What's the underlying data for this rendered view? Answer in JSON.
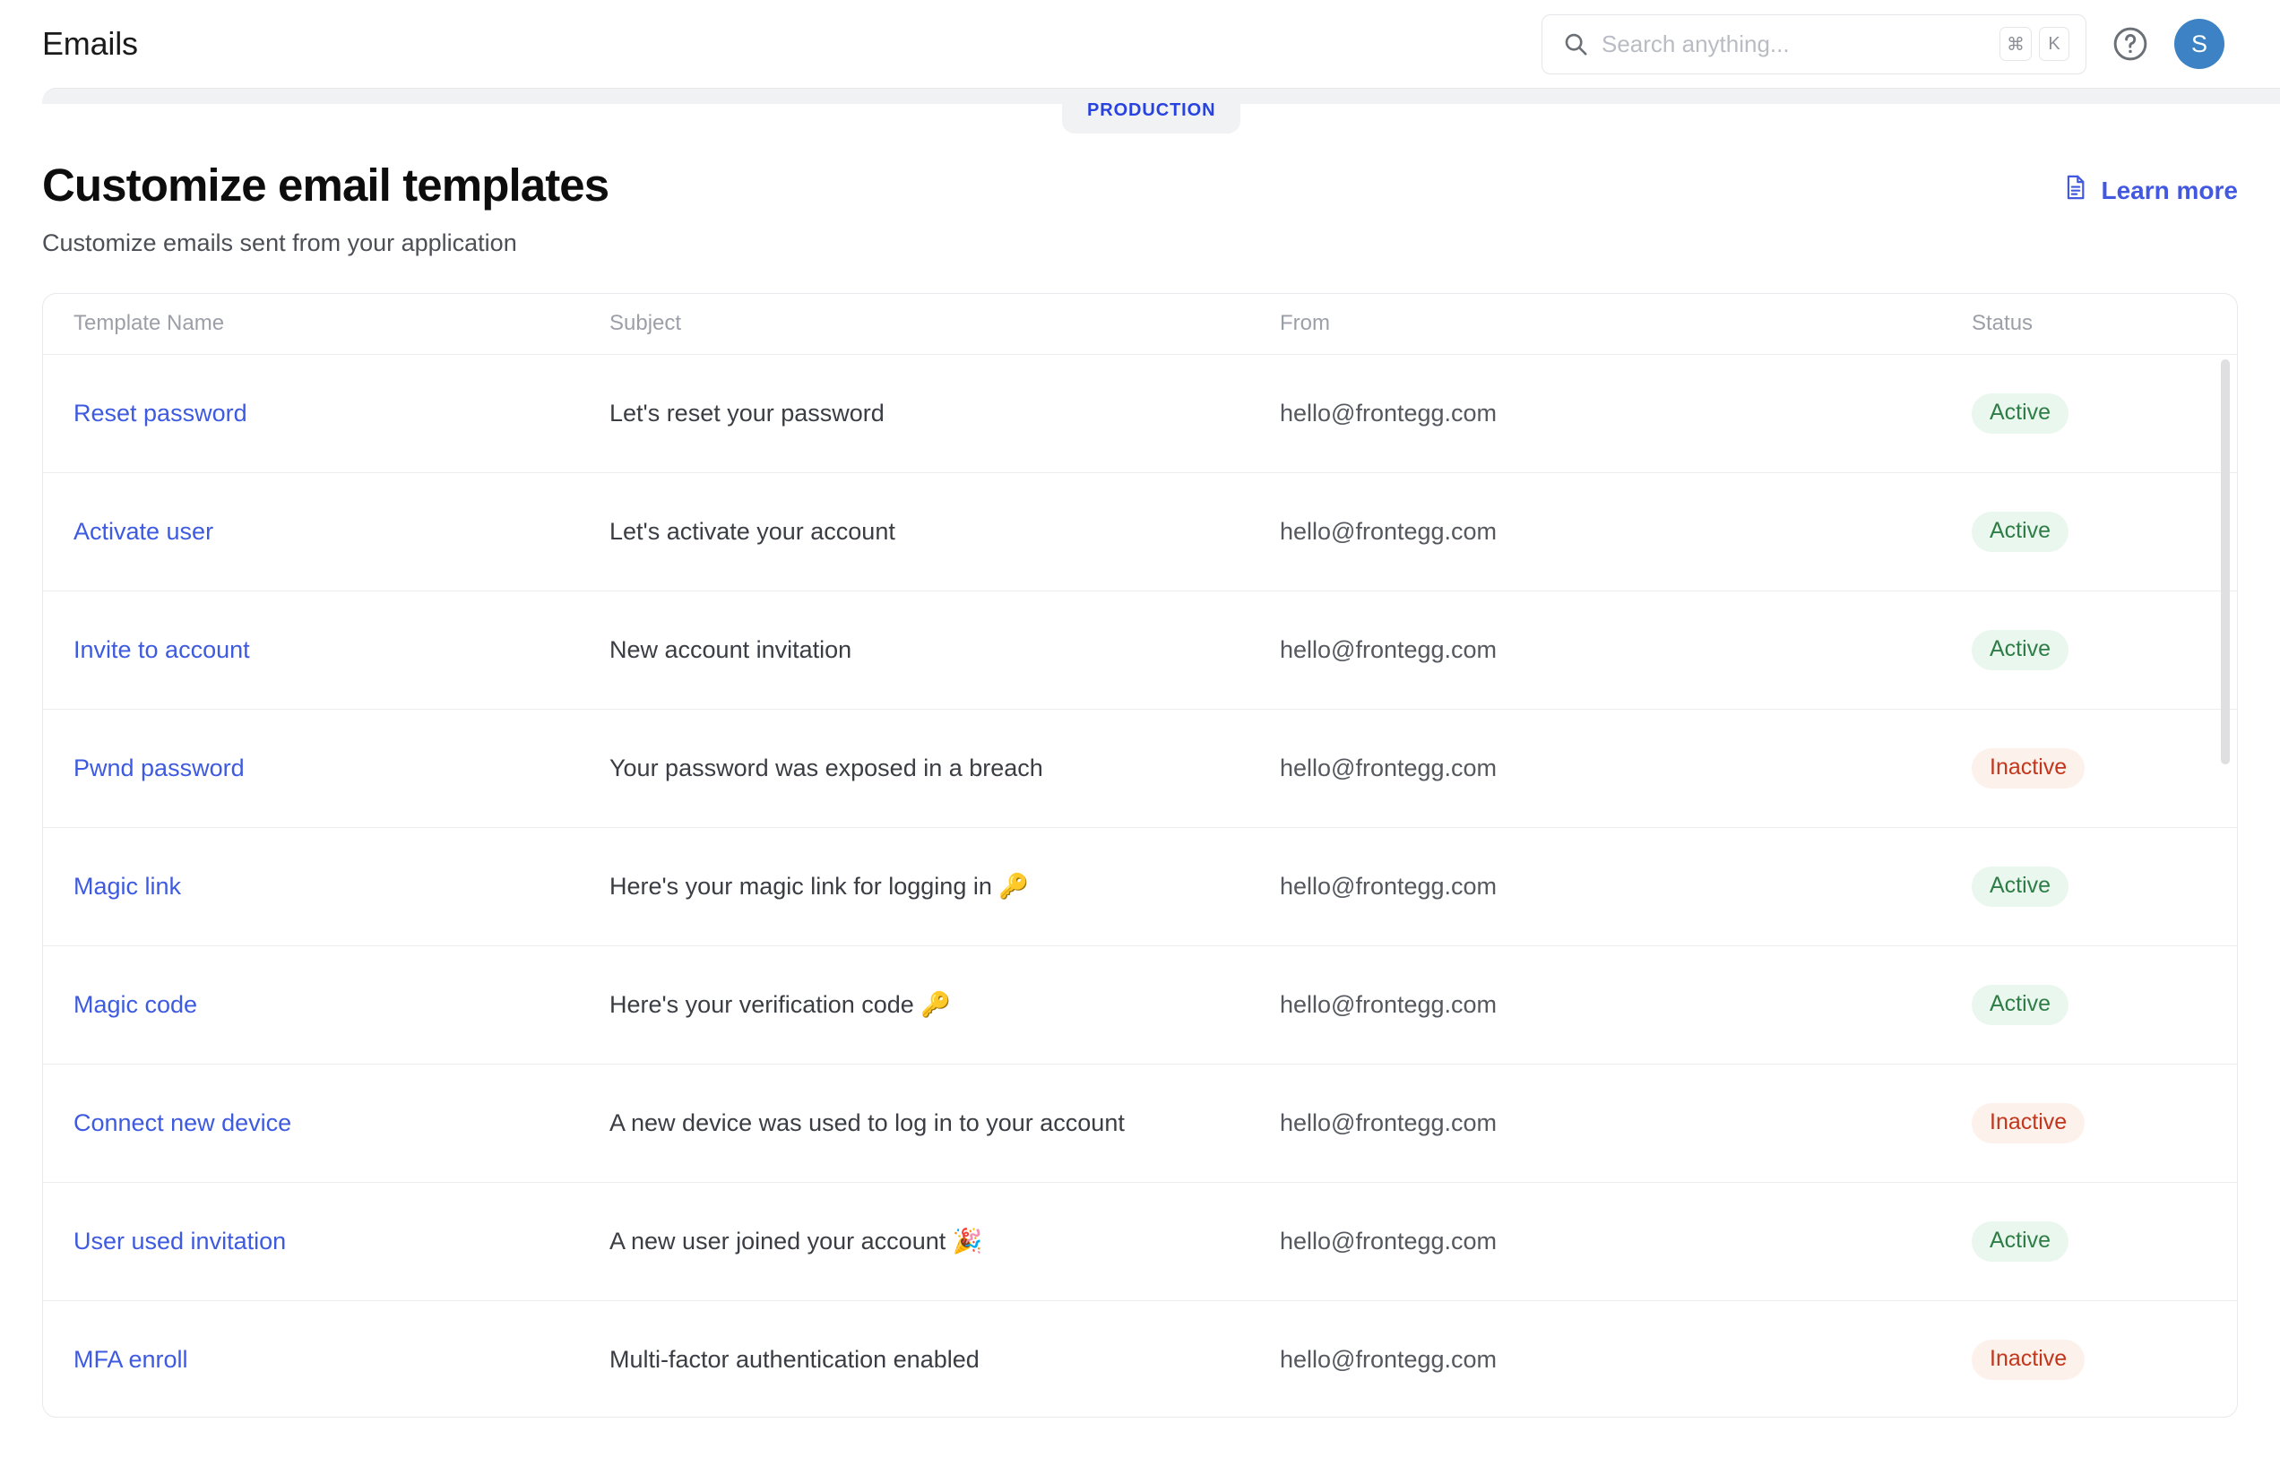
{
  "topbar": {
    "title": "Emails",
    "search": {
      "placeholder": "Search anything...",
      "value": "",
      "shortcut_keys": [
        "⌘",
        "K"
      ]
    },
    "help_icon": "help-circle-icon",
    "avatar_initial": "S",
    "avatar_color": "#3c82c4"
  },
  "environment": {
    "label": "PRODUCTION",
    "text_color": "#2742df",
    "background_color": "#f1f2f4"
  },
  "page": {
    "title": "Customize email templates",
    "subtitle": "Customize emails sent from your application",
    "learn_more": {
      "label": "Learn more",
      "icon": "document-icon",
      "color": "#4258e0"
    }
  },
  "table": {
    "columns": [
      "Template Name",
      "Subject",
      "From",
      "Status"
    ],
    "rows": [
      {
        "name": "Reset password",
        "subject": "Let's reset your password",
        "from": "hello@frontegg.com",
        "status": "Active"
      },
      {
        "name": "Activate user",
        "subject": "Let's activate your account",
        "from": "hello@frontegg.com",
        "status": "Active"
      },
      {
        "name": "Invite to account",
        "subject": "New account invitation",
        "from": "hello@frontegg.com",
        "status": "Active"
      },
      {
        "name": "Pwnd password",
        "subject": "Your password was exposed in a breach",
        "from": "hello@frontegg.com",
        "status": "Inactive"
      },
      {
        "name": "Magic link",
        "subject": "Here's your magic link for logging in 🔑",
        "from": "hello@frontegg.com",
        "status": "Active"
      },
      {
        "name": "Magic code",
        "subject": "Here's your verification code 🔑",
        "from": "hello@frontegg.com",
        "status": "Active"
      },
      {
        "name": "Connect new device",
        "subject": "A new device was used to log in to your account",
        "from": "hello@frontegg.com",
        "status": "Inactive"
      },
      {
        "name": "User used invitation",
        "subject": "A new user joined your account 🎉",
        "from": "hello@frontegg.com",
        "status": "Active"
      },
      {
        "name": "MFA enroll",
        "subject": "Multi-factor authentication enabled",
        "from": "hello@frontegg.com",
        "status": "Inactive"
      }
    ],
    "status_colors": {
      "active_text": "#2e7d46",
      "active_background": "#eaf7ee",
      "inactive_text": "#c2361c",
      "inactive_background": "#fdf1ec"
    }
  }
}
